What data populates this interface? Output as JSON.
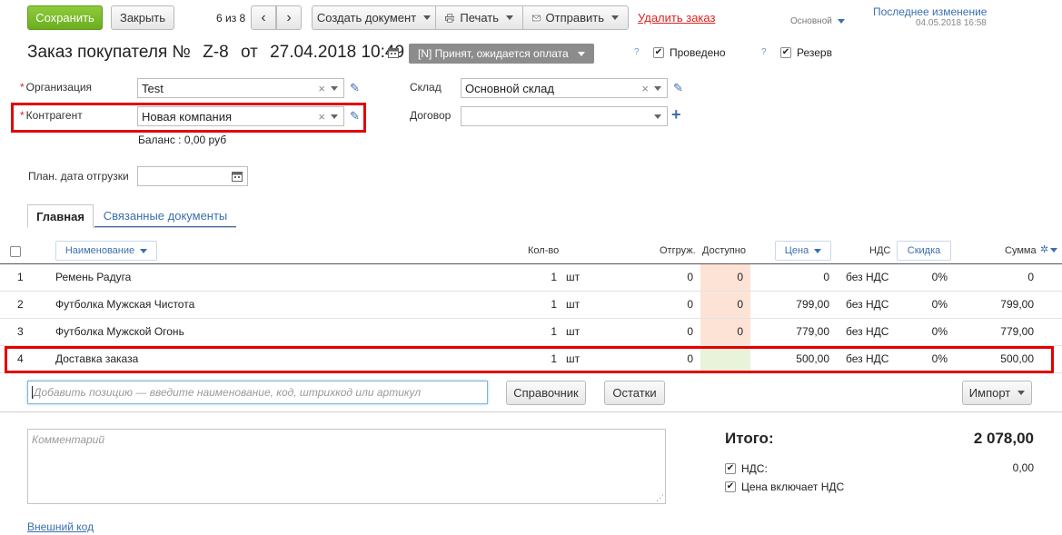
{
  "toolbar": {
    "save": "Сохранить",
    "close": "Закрыть",
    "pager": "6 из 8",
    "create_doc": "Создать документ",
    "print": "Печать",
    "send": "Отправить",
    "delete": "Удалить заказ",
    "profile": "Основной",
    "last_change_label": "Последнее изменение",
    "last_change_date": "04.05.2018 16:58"
  },
  "header": {
    "title_prefix": "Заказ покупателя №",
    "number": "Z-8",
    "from": "от",
    "date": "27.04.2018 10:49",
    "status": "[N] Принят, ожидается оплата",
    "posted_label": "Проведено",
    "reserve_label": "Резерв",
    "help_mark": "?"
  },
  "form": {
    "org_label": "Организация",
    "org_value": "Test",
    "counterparty_label": "Контрагент",
    "counterparty_value": "Новая компания",
    "balance": "Баланс : 0,00 руб",
    "warehouse_label": "Склад",
    "warehouse_value": "Основной склад",
    "contract_label": "Договор",
    "contract_value": "",
    "ship_date_label": "План. дата отгрузки",
    "ship_date_value": ""
  },
  "tabs": [
    {
      "label": "Главная",
      "active": true
    },
    {
      "label": "Связанные документы",
      "active": false
    }
  ],
  "table": {
    "headers": {
      "name": "Наименование",
      "qty": "Кол-во",
      "shipped": "Отгруж.",
      "available": "Доступно",
      "price": "Цена",
      "vat": "НДС",
      "discount": "Скидка",
      "sum": "Сумма"
    },
    "rows": [
      {
        "n": "1",
        "name": "Ремень Радуга",
        "qty": "1",
        "unit": "шт",
        "shipped": "0",
        "available": "0",
        "price": "0",
        "vat": "без НДС",
        "discount": "0%",
        "sum": "0"
      },
      {
        "n": "2",
        "name": "Футболка Мужская Чистота",
        "qty": "1",
        "unit": "шт",
        "shipped": "0",
        "available": "0",
        "price": "799,00",
        "vat": "без НДС",
        "discount": "0%",
        "sum": "799,00"
      },
      {
        "n": "3",
        "name": "Футболка Мужской Огонь",
        "qty": "1",
        "unit": "шт",
        "shipped": "0",
        "available": "0",
        "price": "779,00",
        "vat": "без НДС",
        "discount": "0%",
        "sum": "779,00"
      },
      {
        "n": "4",
        "name": "Доставка заказа",
        "qty": "1",
        "unit": "шт",
        "shipped": "0",
        "available": "",
        "price": "500,00",
        "vat": "без НДС",
        "discount": "0%",
        "sum": "500,00"
      }
    ]
  },
  "add_bar": {
    "placeholder": "Добавить позицию — введите наименование, код, штрихкод или артикул",
    "catalog": "Справочник",
    "stock": "Остатки",
    "import": "Импорт"
  },
  "footer": {
    "comment_placeholder": "Комментарий",
    "external_code": "Внешний код",
    "total_label": "Итого:",
    "total_value": "2 078,00",
    "vat_label": "НДС:",
    "vat_value": "0,00",
    "price_includes_vat": "Цена включает НДС"
  },
  "colors": {
    "accent_green": "#7bbd2a",
    "link_blue": "#3a6fb0",
    "highlight_red": "#e30000",
    "available_zero_bg": "#fde3d6",
    "available_service_bg": "#e8f3da"
  }
}
